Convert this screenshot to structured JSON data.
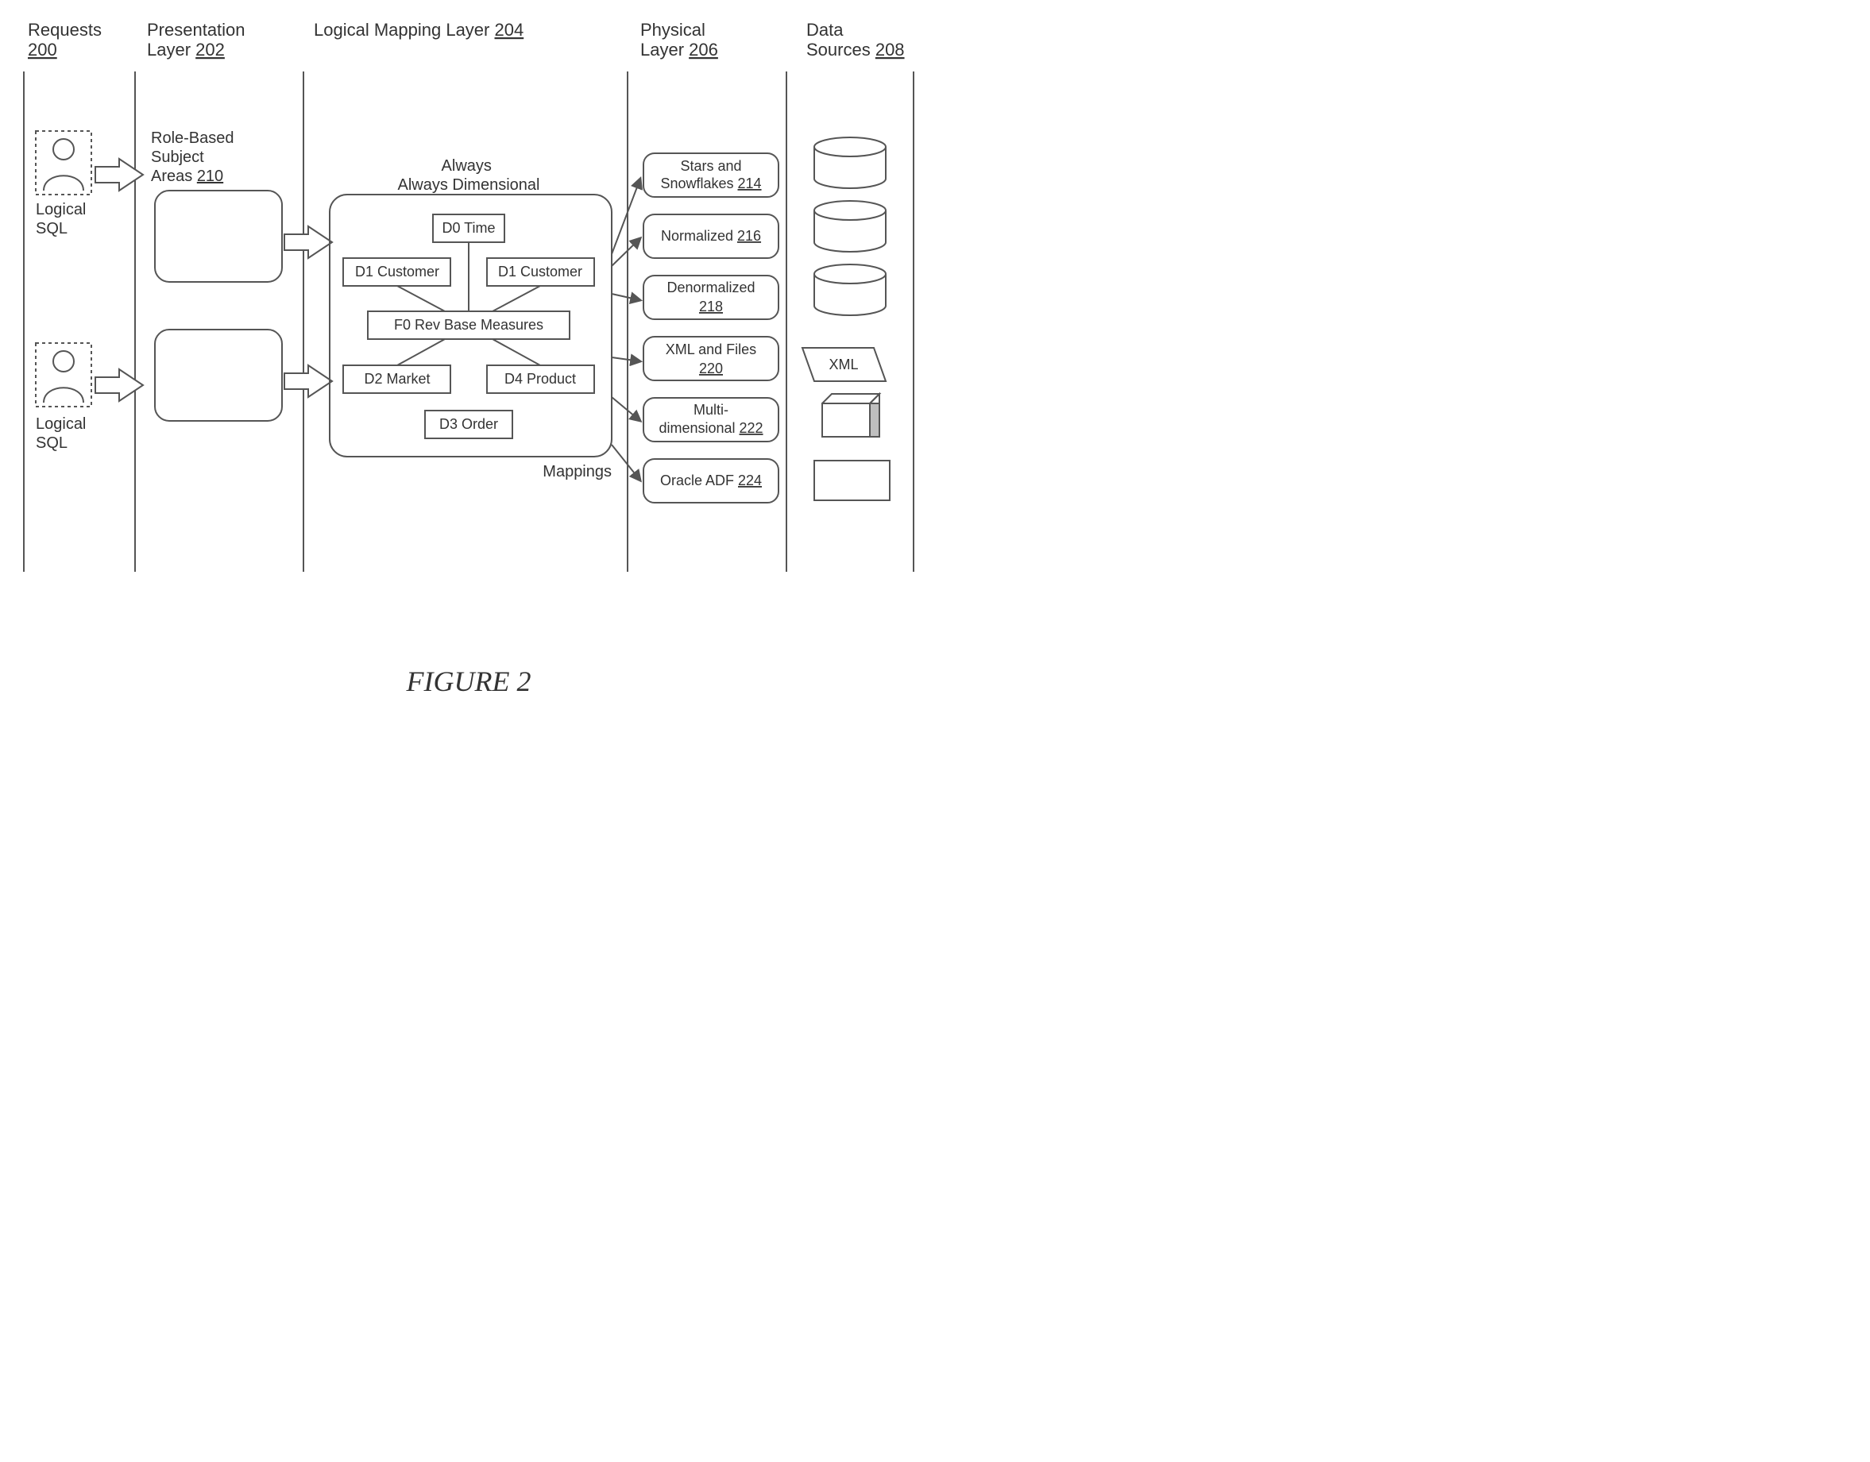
{
  "columns": {
    "requests": {
      "title": "Requests",
      "ref": "200"
    },
    "presentation": {
      "title": "Presentation Layer",
      "ref": "202"
    },
    "logical": {
      "title": "Logical Mapping Layer",
      "ref": "204"
    },
    "physical": {
      "title": "Physical Layer",
      "ref": "206"
    },
    "datasources": {
      "title": "Data Sources",
      "ref": "208"
    }
  },
  "requests_col": {
    "user1_caption": "Logical SQL",
    "user2_caption": "Logical SQL"
  },
  "presentation_col": {
    "heading": "Role-Based Subject Areas",
    "heading_ref": "210"
  },
  "logical_col": {
    "panel_title": "Always Dimensional",
    "boxes": {
      "d0": "D0 Time",
      "d1a": "D1 Customer",
      "d1b": "D1 Customer",
      "f0": "F0 Rev Base Measures",
      "d2": "D2 Market",
      "d4": "D4 Product",
      "d3": "D3 Order"
    },
    "footer": "Mappings"
  },
  "physical_col": {
    "items": [
      {
        "label": "Stars and Snowflakes",
        "ref": "214"
      },
      {
        "label": "Normalized",
        "ref": "216"
      },
      {
        "label": "Denormalized",
        "ref": "218"
      },
      {
        "label": "XML and Files",
        "ref": "220"
      },
      {
        "label": "Multi-dimensional",
        "ref": "222"
      },
      {
        "label": "Oracle ADF",
        "ref": "224"
      }
    ]
  },
  "datasources_col": {
    "xml_label": "XML"
  },
  "figure_caption": "FIGURE 2"
}
